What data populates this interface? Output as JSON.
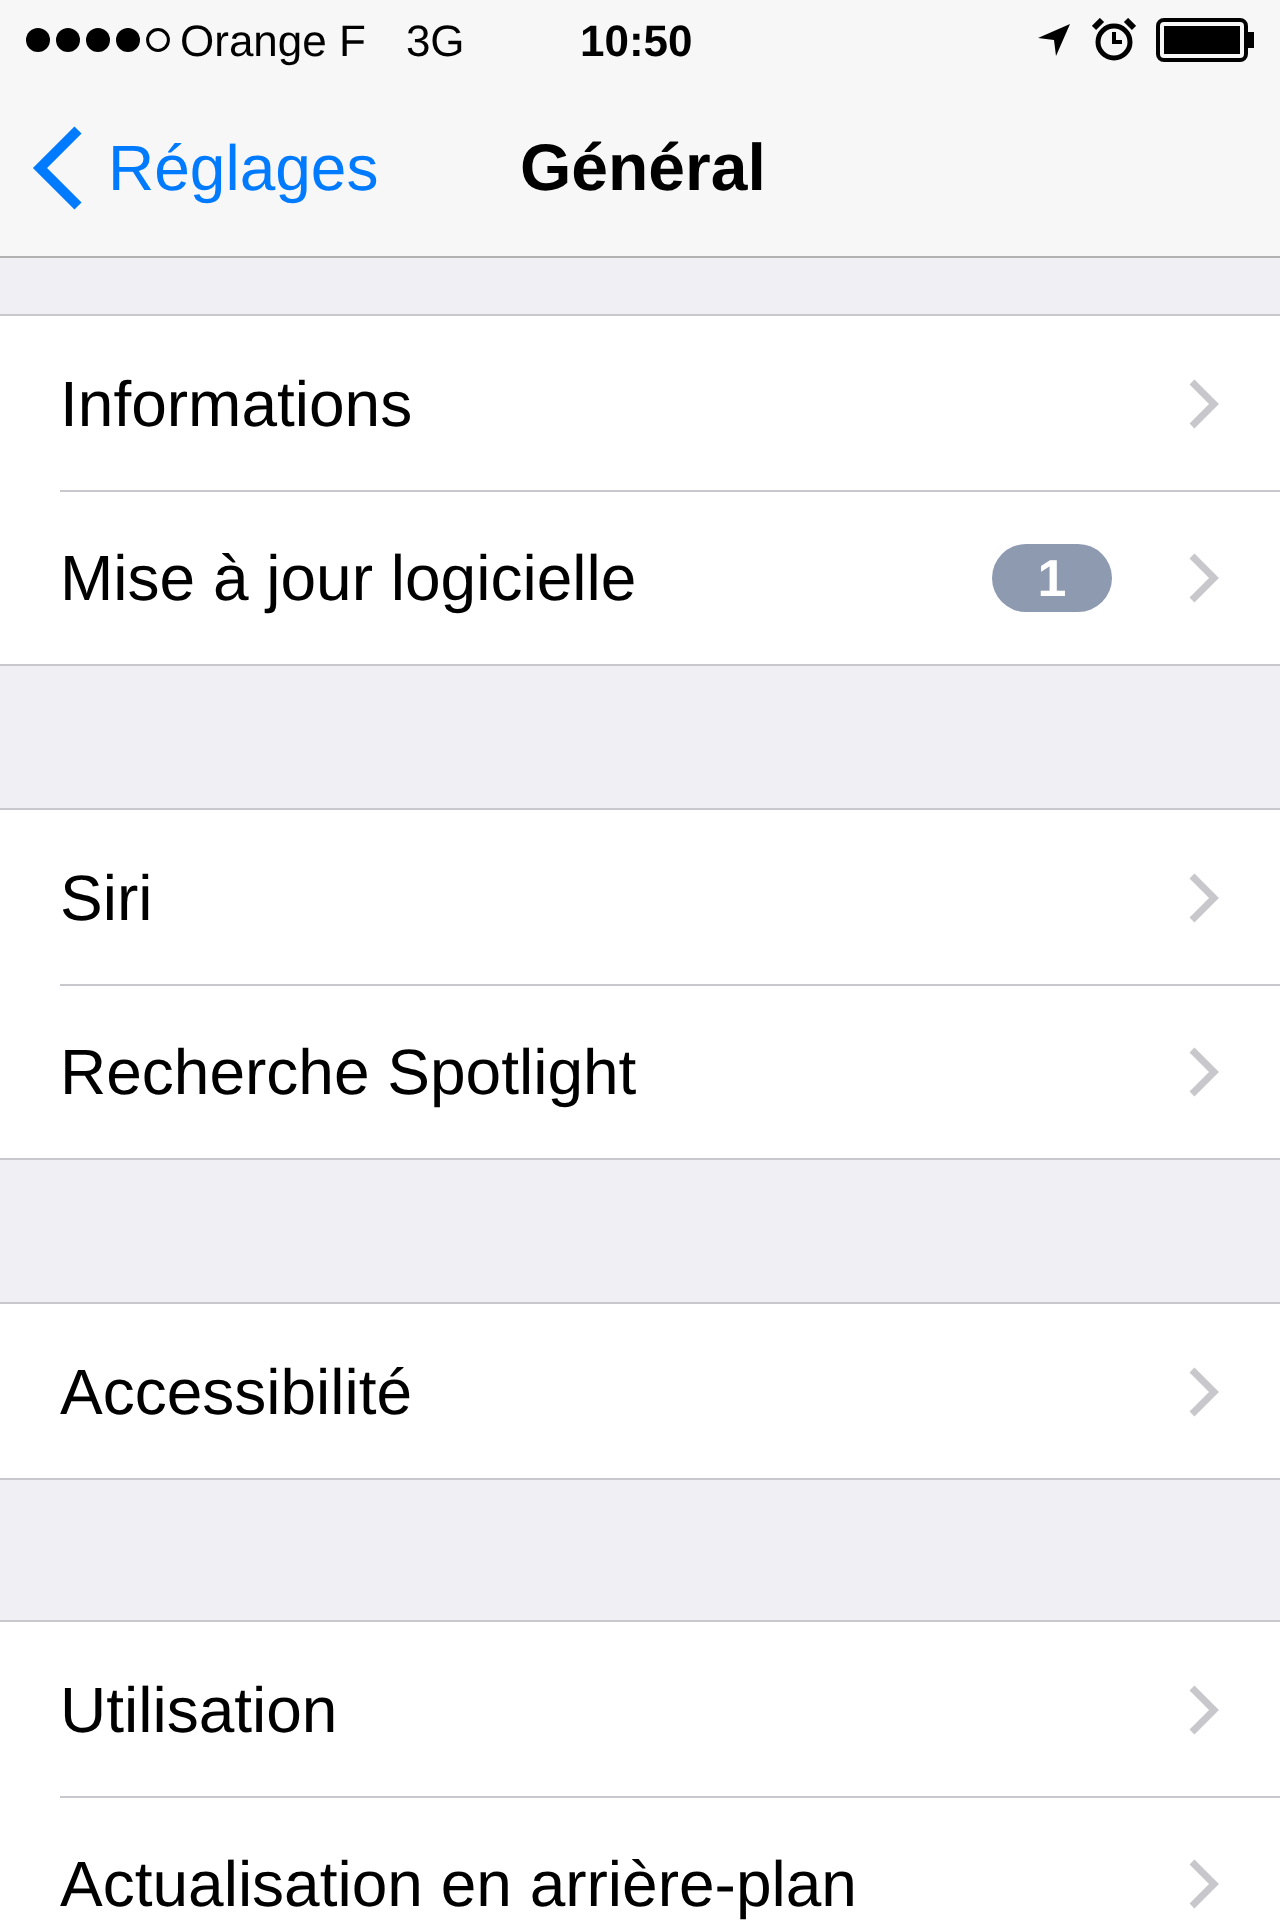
{
  "status_bar": {
    "carrier": "Orange F",
    "network": "3G",
    "time": "10:50"
  },
  "nav_bar": {
    "back": "Réglages",
    "title": "Général"
  },
  "groups": [
    {
      "items": [
        {
          "label": "Informations"
        },
        {
          "label": "Mise à jour logicielle",
          "badge": "1"
        }
      ]
    },
    {
      "items": [
        {
          "label": "Siri"
        },
        {
          "label": "Recherche Spotlight"
        }
      ]
    },
    {
      "items": [
        {
          "label": "Accessibilité"
        }
      ]
    },
    {
      "items": [
        {
          "label": "Utilisation"
        },
        {
          "label": "Actualisation en arrière-plan"
        }
      ]
    }
  ]
}
